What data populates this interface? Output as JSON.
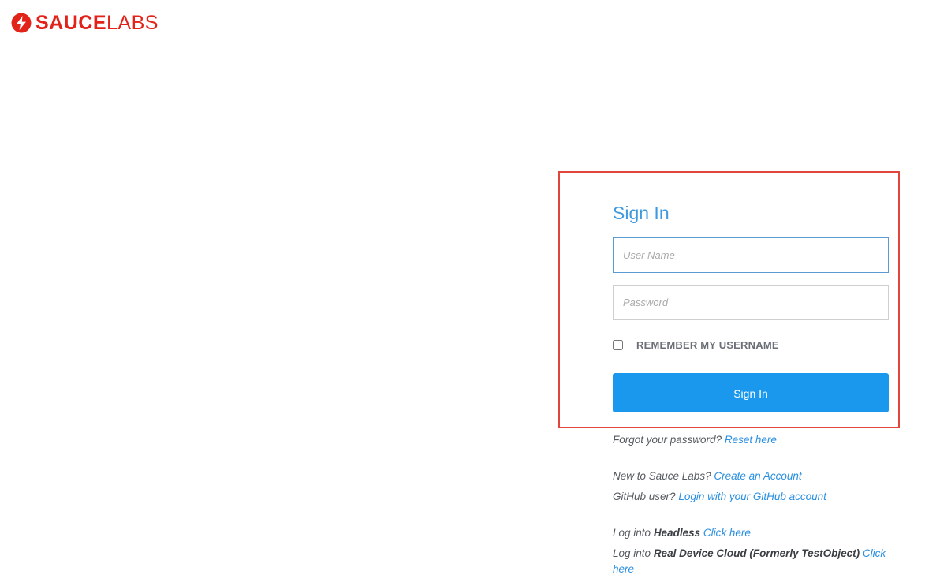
{
  "brand": {
    "name_bold": "SAUCE",
    "name_light": "LABS",
    "logo_icon": "sauce-bolt-icon",
    "color": "#e2231a"
  },
  "form": {
    "title": "Sign In",
    "username_placeholder": "User Name",
    "password_placeholder": "Password",
    "remember_label": "REMEMBER MY USERNAME",
    "submit_label": "Sign In",
    "button_color": "#1a98ee",
    "highlight_color": "#e0463b"
  },
  "links": {
    "forgot_prefix": "Forgot your password?",
    "forgot_link": "Reset here",
    "new_prefix": "New to Sauce Labs?",
    "new_link": "Create an Account",
    "github_prefix": "GitHub user?",
    "github_link": "Login with your GitHub account",
    "headless_prefix": "Log into",
    "headless_name": "Headless",
    "headless_link": "Click here",
    "rdc_prefix": "Log into",
    "rdc_name": "Real Device Cloud (Formerly TestObject)",
    "rdc_link": "Click here"
  }
}
